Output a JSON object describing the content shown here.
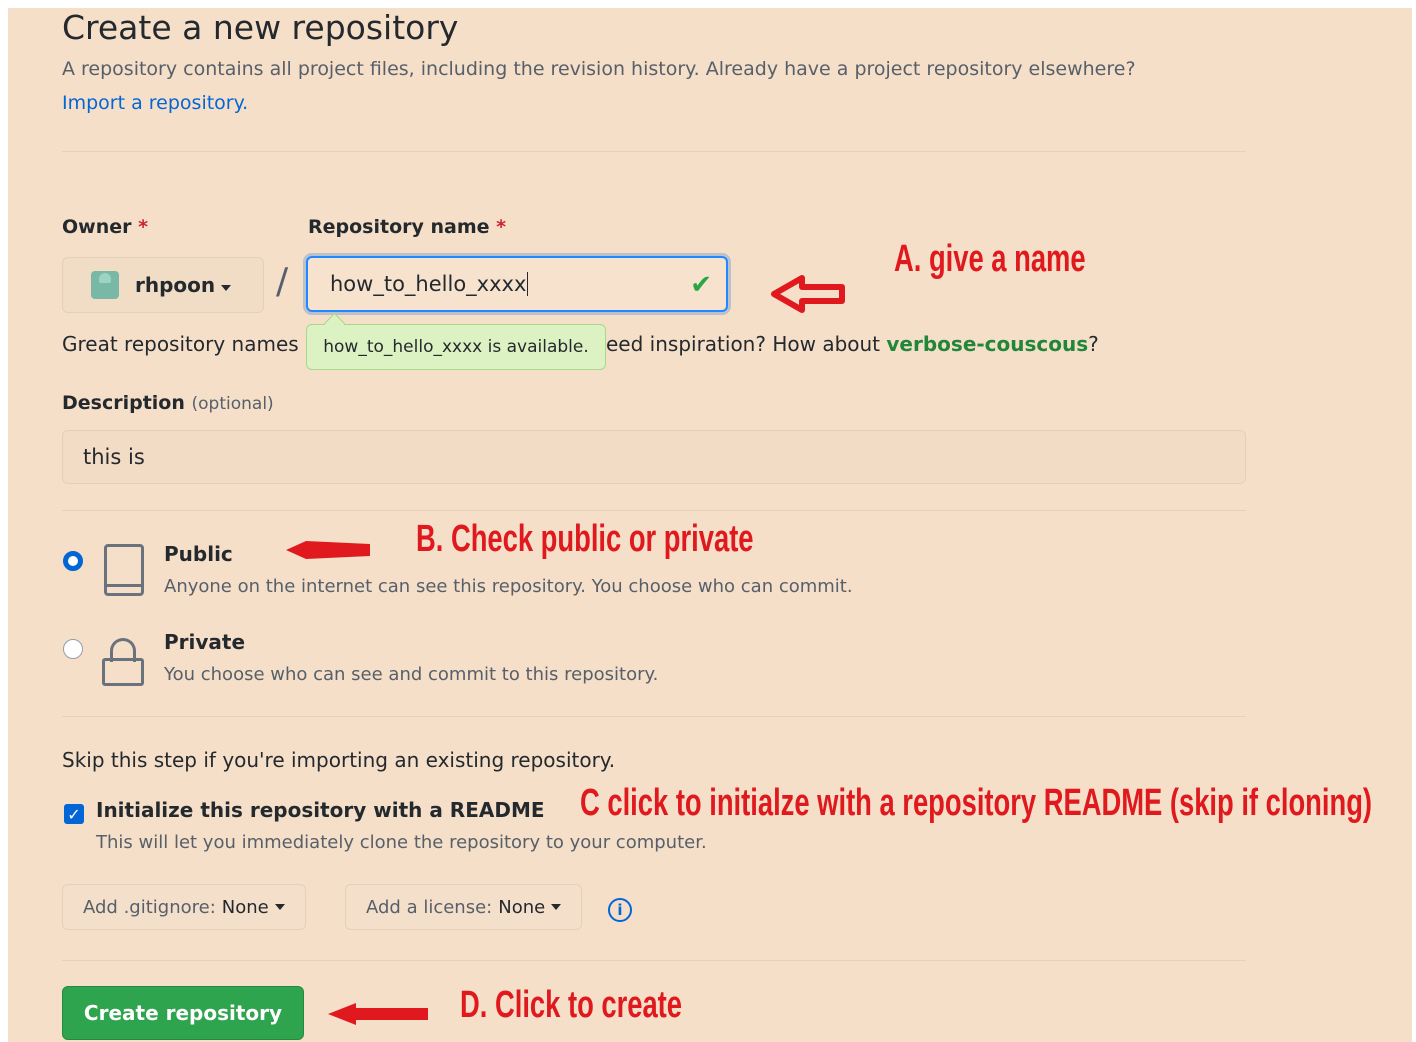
{
  "header": {
    "title": "Create a new repository",
    "subtitle": "A repository contains all project files, including the revision history. Already have a project repository elsewhere?",
    "import_link": "Import a repository."
  },
  "owner": {
    "label": "Owner",
    "required_mark": "*",
    "value": "rhpoon"
  },
  "repo_name": {
    "label": "Repository name",
    "required_mark": "*",
    "value": "how_to_hello_xxxx",
    "availability": "how_to_hello_xxxx is available.",
    "separator": "/"
  },
  "hint": {
    "prefix": "Great repository names",
    "middle": "eed inspiration? How about",
    "suggestion": "verbose-couscous",
    "suffix": "?"
  },
  "description": {
    "label": "Description",
    "optional": "(optional)",
    "value": "this is"
  },
  "visibility": {
    "public": {
      "title": "Public",
      "desc": "Anyone on the internet can see this repository. You choose who can commit.",
      "selected": true
    },
    "private": {
      "title": "Private",
      "desc": "You choose who can see and commit to this repository.",
      "selected": false
    }
  },
  "init": {
    "skip_text": "Skip this step if you're importing an existing repository.",
    "readme_label": "Initialize this repository with a README",
    "readme_desc": "This will let you immediately clone the repository to your computer.",
    "readme_checked": true,
    "gitignore_prefix": "Add .gitignore:",
    "gitignore_value": "None",
    "license_prefix": "Add a license:",
    "license_value": "None"
  },
  "submit": {
    "label": "Create repository"
  },
  "annotations": {
    "a": "A. give a name",
    "b": "B. Check public or private",
    "c": "C  click to initialze with a repository README (skip if cloning)",
    "d": "D.  Click to create"
  },
  "colors": {
    "background": "#f5dfc8",
    "primary_button": "#2ea44f",
    "link": "#0366d6",
    "annotation": "#e0191e",
    "success": "#28a745"
  },
  "icons": [
    "avatar",
    "caret-down-icon",
    "check-icon",
    "repo-icon",
    "lock-icon",
    "info-icon",
    "red-arrow-icon"
  ]
}
